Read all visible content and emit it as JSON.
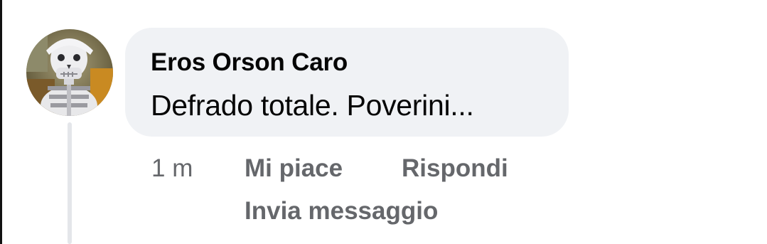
{
  "comment": {
    "author": "Eros Orson Caro",
    "text": "Defrado totale. Poverini...",
    "time": "1 m",
    "actions": {
      "like": "Mi piace",
      "reply": "Rispondi",
      "message": "Invia messaggio"
    },
    "avatar_icon": "skeleton-avatar"
  },
  "colors": {
    "bubble": "#f0f2f5",
    "text_primary": "#050505",
    "text_secondary": "#65676b",
    "thread_line": "#e4e6ea"
  }
}
